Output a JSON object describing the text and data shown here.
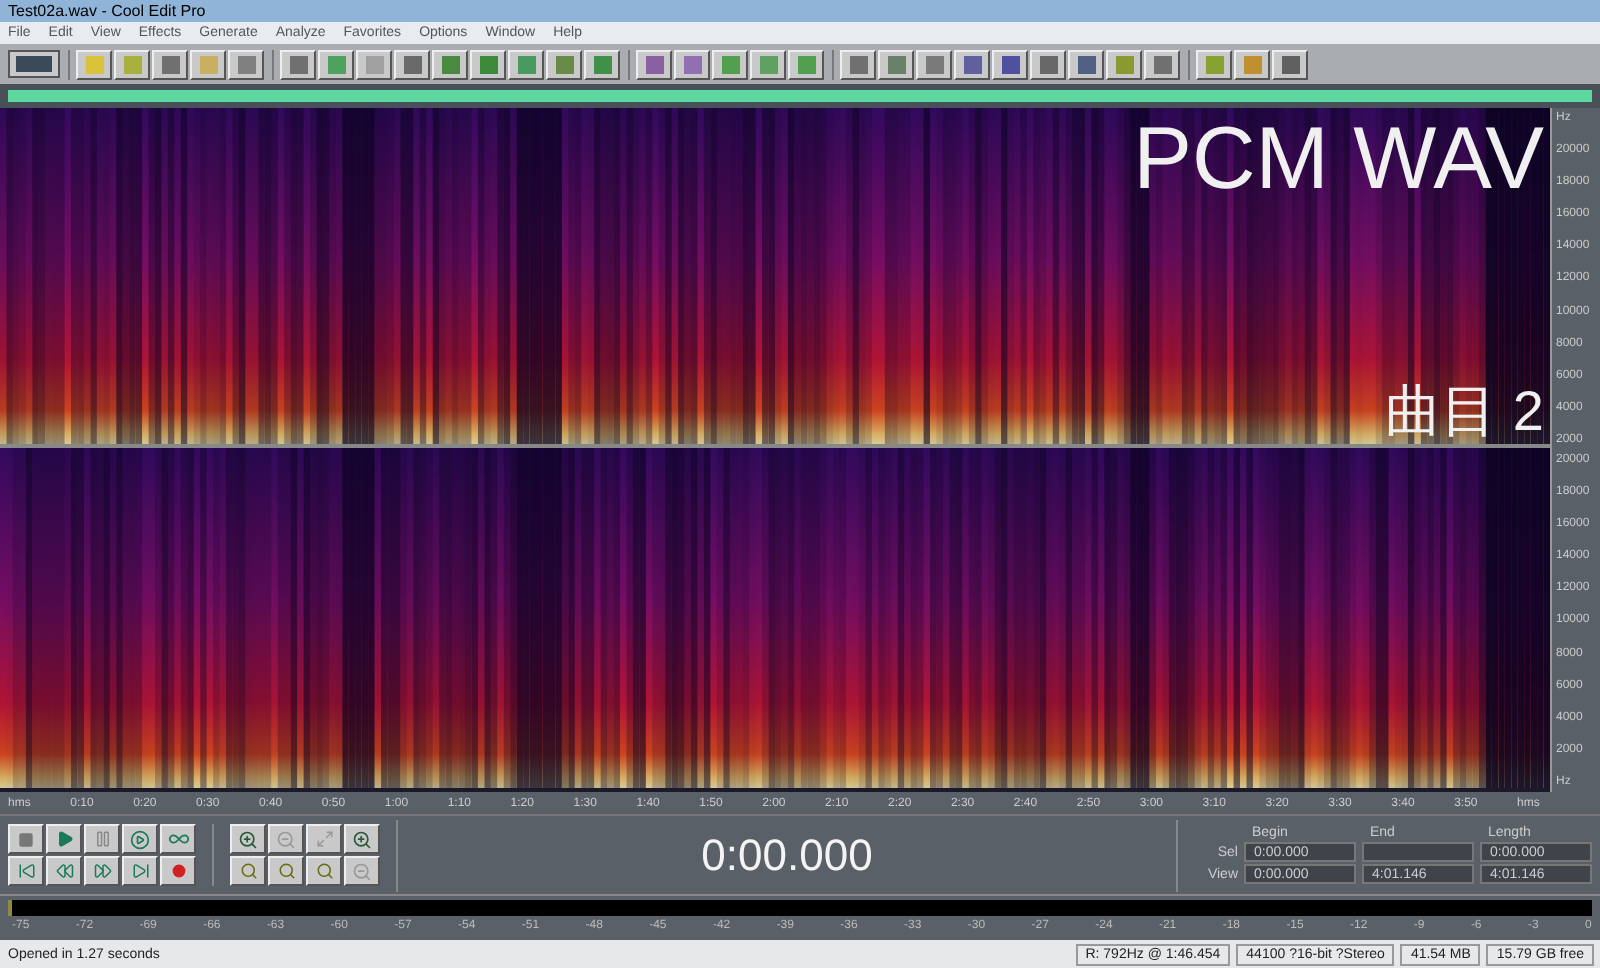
{
  "window": {
    "title": "Test02a.wav - Cool Edit Pro"
  },
  "menu": [
    "File",
    "Edit",
    "View",
    "Effects",
    "Generate",
    "Analyze",
    "Favorites",
    "Options",
    "Window",
    "Help"
  ],
  "overlay_labels": [
    "PCM WAV",
    "曲目 2"
  ],
  "frequency_axes": [
    {
      "labels": [
        "Hz",
        "20000",
        "18000",
        "16000",
        "14000",
        "12000",
        "10000",
        "8000",
        "6000",
        "4000",
        "2000"
      ]
    },
    {
      "labels": [
        "20000",
        "18000",
        "16000",
        "14000",
        "12000",
        "10000",
        "8000",
        "6000",
        "4000",
        "2000",
        "Hz"
      ]
    }
  ],
  "time_ruler": [
    "hms",
    "0:10",
    "0:20",
    "0:30",
    "0:40",
    "0:50",
    "1:00",
    "1:10",
    "1:20",
    "1:30",
    "1:40",
    "1:50",
    "2:00",
    "2:10",
    "2:20",
    "2:30",
    "2:40",
    "2:50",
    "3:00",
    "3:10",
    "3:20",
    "3:30",
    "3:40",
    "3:50",
    "hms"
  ],
  "time_display": "0:00.000",
  "selection_panel": {
    "columns": [
      "Begin",
      "End",
      "Length"
    ],
    "rows": [
      {
        "label": "Sel",
        "cells": [
          {
            "text": "0:00.000"
          },
          {
            "blank": true
          },
          {
            "text": "0:00.000"
          }
        ]
      },
      {
        "label": "View",
        "cells": [
          {
            "text": "0:00.000"
          },
          {
            "text": "4:01.146"
          },
          {
            "text": "4:01.146"
          }
        ]
      }
    ]
  },
  "level_meter": [
    "-75",
    "-72",
    "-69",
    "-66",
    "-63",
    "-60",
    "-57",
    "-54",
    "-51",
    "-48",
    "-45",
    "-42",
    "-39",
    "-36",
    "-33",
    "-30",
    "-27",
    "-24",
    "-21",
    "-18",
    "-15",
    "-12",
    "-9",
    "-6",
    "-3",
    "0"
  ],
  "status_bar": {
    "message": "Opened in 1.27 seconds",
    "fields": [
      "R: 792Hz @  1:46.454",
      "44100 ?16-bit ?Stereo",
      "41.54 MB",
      "15.79 GB free"
    ]
  }
}
